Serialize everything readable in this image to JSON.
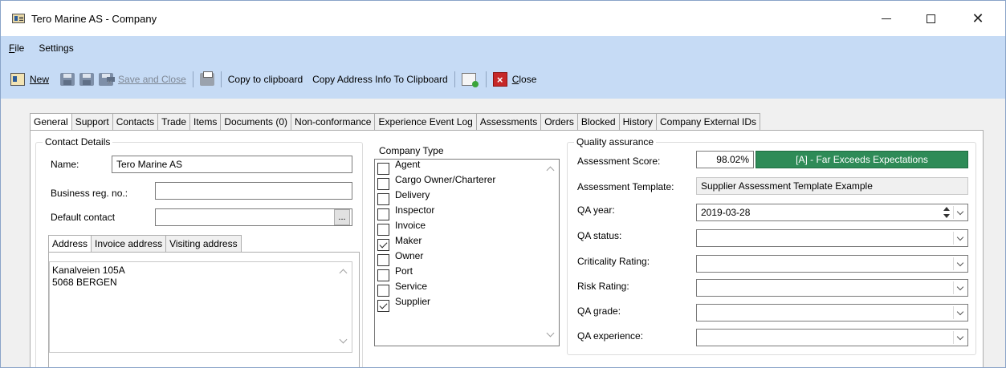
{
  "window": {
    "title": "Tero Marine AS - Company",
    "minimize_label": "—",
    "close_label": "✕"
  },
  "menu": {
    "file": "File",
    "settings": "Settings"
  },
  "toolbar": {
    "new": "New",
    "save_and_close": "Save and Close",
    "copy_to_clipboard": "Copy to clipboard",
    "copy_address": "Copy Address Info To Clipboard",
    "close_first": "C",
    "close_rest": "lose"
  },
  "tabs": [
    "General",
    "Support",
    "Contacts",
    "Trade",
    "Items",
    "Documents (0)",
    "Non-conformance",
    "Experience Event Log",
    "Assessments",
    "Orders",
    "Blocked",
    "History",
    "Company External IDs"
  ],
  "contact_details": {
    "title": "Contact Details",
    "name_label": "Name:",
    "name_value": "Tero Marine AS",
    "business_reg_label": "Business reg. no.:",
    "business_reg_value": "",
    "default_contact_label": "Default contact",
    "default_contact_value": "",
    "ellipsis": "..."
  },
  "address_tabs": [
    "Address",
    "Invoice address",
    "Visiting address"
  ],
  "address": {
    "line1": "Kanalveien 105A",
    "line2": "5068 BERGEN"
  },
  "company_type": {
    "title": "Company Type",
    "items": [
      {
        "label": "Agent",
        "checked": false
      },
      {
        "label": "Cargo Owner/Charterer",
        "checked": false
      },
      {
        "label": "Delivery",
        "checked": false
      },
      {
        "label": "Inspector",
        "checked": false
      },
      {
        "label": "Invoice",
        "checked": false
      },
      {
        "label": "Maker",
        "checked": true
      },
      {
        "label": "Owner",
        "checked": false
      },
      {
        "label": "Port",
        "checked": false
      },
      {
        "label": "Service",
        "checked": false
      },
      {
        "label": "Supplier",
        "checked": true
      }
    ]
  },
  "quality_assurance": {
    "title": "Quality assurance",
    "assessment_score_label": "Assessment Score:",
    "assessment_score_value": "98.02%",
    "assessment_grade": "[A] - Far Exceeds Expectations",
    "assessment_template_label": "Assessment Template:",
    "assessment_template_value": "Supplier Assessment Template Example",
    "qa_year_label": "QA year:",
    "qa_year_value": "2019-03-28",
    "qa_status_label": "QA status:",
    "criticality_label": "Criticality Rating:",
    "risk_label": "Risk Rating:",
    "qa_grade_label": "QA grade:",
    "qa_experience_label": "QA experience:"
  },
  "colors": {
    "menu_bg": "#c6dbf5",
    "grade_badge": "#2e8b57",
    "close_icon": "#c62828"
  }
}
